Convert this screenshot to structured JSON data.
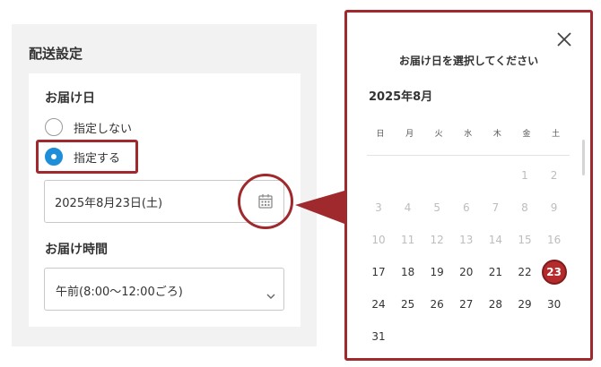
{
  "left_panel": {
    "title": "配送設定",
    "date_section": {
      "label": "お届け日",
      "options": [
        {
          "label": "指定しない",
          "selected": false
        },
        {
          "label": "指定する",
          "selected": true
        }
      ],
      "date_value": "2025年8月23日(土)"
    },
    "time_section": {
      "label": "お届け時間",
      "selected_value": "午前(8:00～12:00ごろ)"
    }
  },
  "popup": {
    "title": "お届け日を選択してください",
    "month": "2025年8月",
    "weekdays": [
      "日",
      "月",
      "火",
      "水",
      "木",
      "金",
      "土"
    ],
    "weeks": [
      [
        "",
        "",
        "",
        "",
        "",
        "1",
        "2"
      ],
      [
        "3",
        "4",
        "5",
        "6",
        "7",
        "8",
        "9"
      ],
      [
        "10",
        "11",
        "12",
        "13",
        "14",
        "15",
        "16"
      ],
      [
        "17",
        "18",
        "19",
        "20",
        "21",
        "22",
        "23"
      ],
      [
        "24",
        "25",
        "26",
        "27",
        "28",
        "29",
        "30"
      ],
      [
        "31",
        "",
        "",
        "",
        "",
        "",
        ""
      ]
    ],
    "first_available_day": 17,
    "selected_day": 23
  },
  "colors": {
    "highlight": "#a0292d",
    "selected_day": "#b52b2b",
    "radio_on": "#1e8ed8",
    "disabled_text": "#bdbdbd",
    "panel_bg": "#f2f2f2"
  },
  "icons": {
    "calendar": "calendar-icon",
    "dropdown": "chevron-down-icon",
    "close": "close-icon"
  }
}
